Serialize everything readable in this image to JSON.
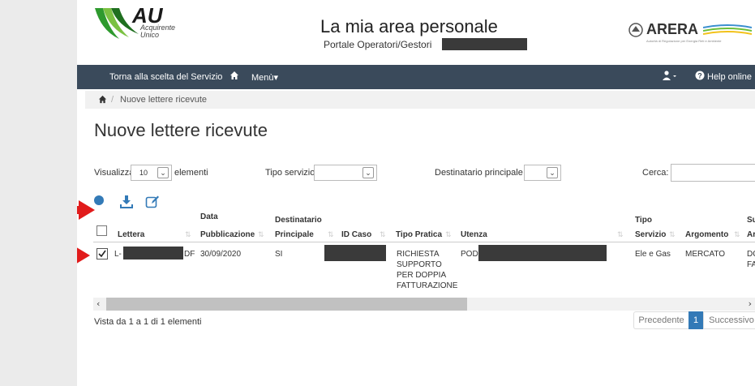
{
  "header": {
    "logo_text": "AU",
    "logo_sub1": "Acquirente",
    "logo_sub2": "Unico",
    "title": "La mia area personale",
    "subtitle": "Portale Operatori/Gestori",
    "arera_text": "ARERA",
    "arera_sub": "Autorità di Regolazione per Energia Reti e Ambiente"
  },
  "nav": {
    "back": "Torna alla scelta del Servizio",
    "menu": "Menù",
    "help": "Help online"
  },
  "breadcrumb": {
    "current": "Nuove lettere ricevute"
  },
  "page_title": "Nuove lettere ricevute",
  "controls": {
    "show_label": "Visualizza",
    "show_value": "10",
    "elements_label": "elementi",
    "tipo_servizio_label": "Tipo servizio",
    "destinatario_label": "Destinatario principale",
    "search_label": "Cerca:"
  },
  "table": {
    "headers": {
      "lettera": "Lettera",
      "data_pub_1": "Data",
      "data_pub_2": "Pubblicazione",
      "dest_1": "Destinatario",
      "dest_2": "Principale",
      "id_caso": "ID Caso",
      "tipo_pratica": "Tipo Pratica",
      "utenza": "Utenza",
      "tipo_servizio_1": "Tipo",
      "tipo_servizio_2": "Servizio",
      "argomento": "Argomento",
      "sub_1": "Su",
      "sub_2": "Ar"
    },
    "row": {
      "lettera_prefix": "L-",
      "lettera_suffix": "DF",
      "data": "30/09/2020",
      "dest": "SI",
      "tipo_pratica_1": "RICHIESTA",
      "tipo_pratica_2": "SUPPORTO",
      "tipo_pratica_3": "PER DOPPIA",
      "tipo_pratica_4": "FATTURAZIONE",
      "utenza_prefix": "POD:",
      "tipo_servizio": "Ele e Gas",
      "argomento": "MERCATO",
      "sub_1": "DO",
      "sub_2": "FA"
    }
  },
  "footer": {
    "info": "Vista da 1 a 1 di 1 elementi",
    "prev": "Precedente",
    "page": "1",
    "next": "Successivo"
  },
  "colors": {
    "nav_bg": "#3a4a5b",
    "accent": "#337ab7",
    "arrow": "#e11b1b"
  }
}
